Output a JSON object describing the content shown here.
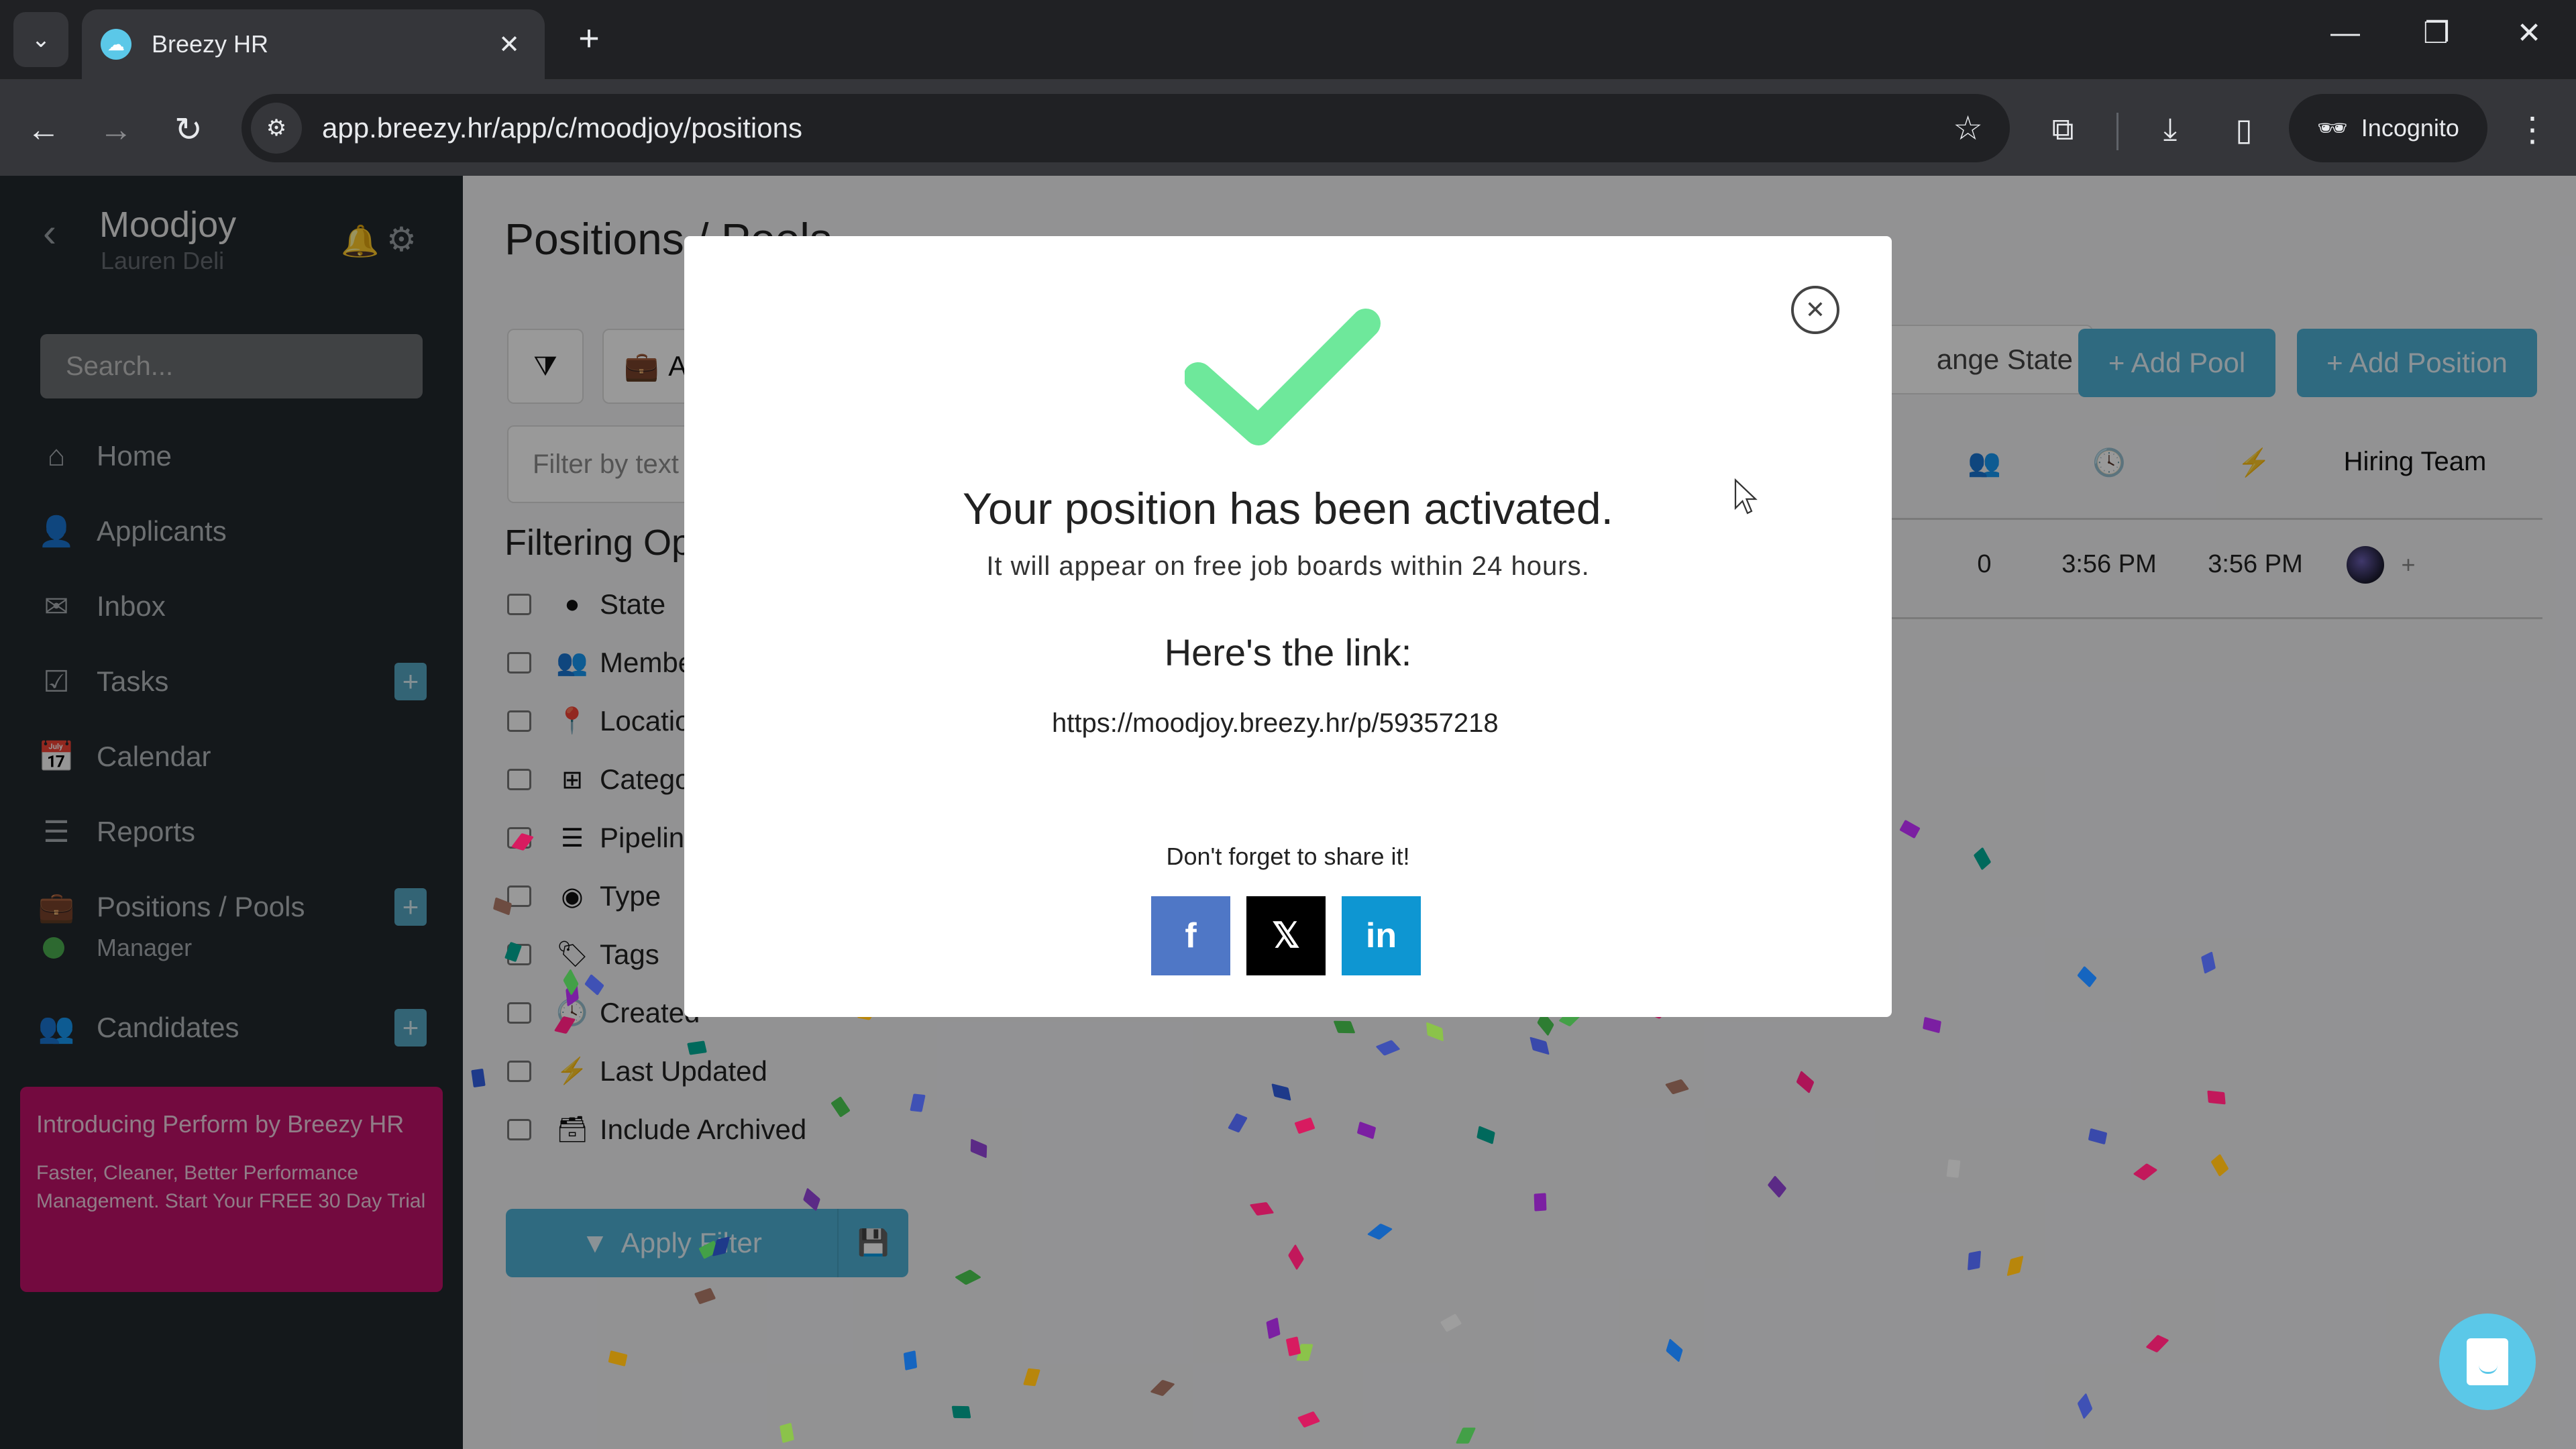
{
  "browser": {
    "tab_title": "Breezy HR",
    "url": "app.breezy.hr/app/c/moodjoy/positions",
    "incognito_label": "Incognito"
  },
  "sidebar": {
    "company": "Moodjoy",
    "user": "Lauren Deli",
    "search_placeholder": "Search...",
    "items": [
      {
        "label": "Home",
        "icon": "home-icon"
      },
      {
        "label": "Applicants",
        "icon": "user-icon"
      },
      {
        "label": "Inbox",
        "icon": "envelope-icon"
      },
      {
        "label": "Tasks",
        "icon": "checkbox-icon",
        "plus": true
      },
      {
        "label": "Calendar",
        "icon": "calendar-icon"
      },
      {
        "label": "Reports",
        "icon": "bar-chart-icon"
      },
      {
        "label": "Positions / Pools",
        "icon": "briefcase-icon",
        "plus": true
      },
      {
        "label": "Candidates",
        "icon": "users-icon",
        "plus": true
      }
    ],
    "sub_item": {
      "label": "Manager",
      "status_color": "#4caf50"
    },
    "promo": {
      "title": "Introducing Perform by Breezy HR",
      "body": "Faster, Cleaner, Better Performance Management. Start Your FREE 30 Day Trial"
    }
  },
  "main": {
    "page_title": "Positions / Pools",
    "all_button_label": "Al",
    "filter_placeholder": "Filter by text",
    "filtering_title": "Filtering Op",
    "filter_options": [
      {
        "label": "State",
        "icon": "circle-icon"
      },
      {
        "label": "Membe",
        "icon": "users-icon"
      },
      {
        "label": "Locatio",
        "icon": "map-pin-icon"
      },
      {
        "label": "Catego",
        "icon": "grid-icon"
      },
      {
        "label": "Pipeline",
        "icon": "ordered-list-icon"
      },
      {
        "label": "Type",
        "icon": "user-circle-icon"
      },
      {
        "label": "Tags",
        "icon": "tag-icon"
      },
      {
        "label": "Created",
        "icon": "clock-icon"
      },
      {
        "label": "Last Updated",
        "icon": "bolt-icon"
      },
      {
        "label": "Include Archived",
        "icon": "archive-icon"
      }
    ],
    "apply_filter_label": "Apply Filter",
    "change_state_label": "ange State",
    "add_pool_label": "+ Add Pool",
    "add_position_label": "+ Add Position",
    "table": {
      "headers": {
        "hiring_team": "Hiring Team"
      },
      "rows": [
        {
          "candidates": "0",
          "created": "3:56 PM",
          "updated": "3:56 PM"
        }
      ]
    }
  },
  "modal": {
    "title": "Your position has been activated.",
    "subtitle": "It will appear on free job boards within 24 hours.",
    "link_label": "Here's the link:",
    "link": "https://moodjoy.breezy.hr/p/59357218",
    "share_prompt": "Don't forget to share it!",
    "share": [
      {
        "network": "facebook",
        "glyph": "f",
        "color": "#4f77c6"
      },
      {
        "network": "x",
        "glyph": "𝕏",
        "color": "#000000"
      },
      {
        "network": "linkedin",
        "glyph": "in",
        "color": "#0e96d2"
      }
    ],
    "check_color": "#6ee89b"
  },
  "colors": {
    "accent": "#4fb1d6",
    "sidebar_bg": "#22282d",
    "promo_bg": "#c0116a"
  }
}
